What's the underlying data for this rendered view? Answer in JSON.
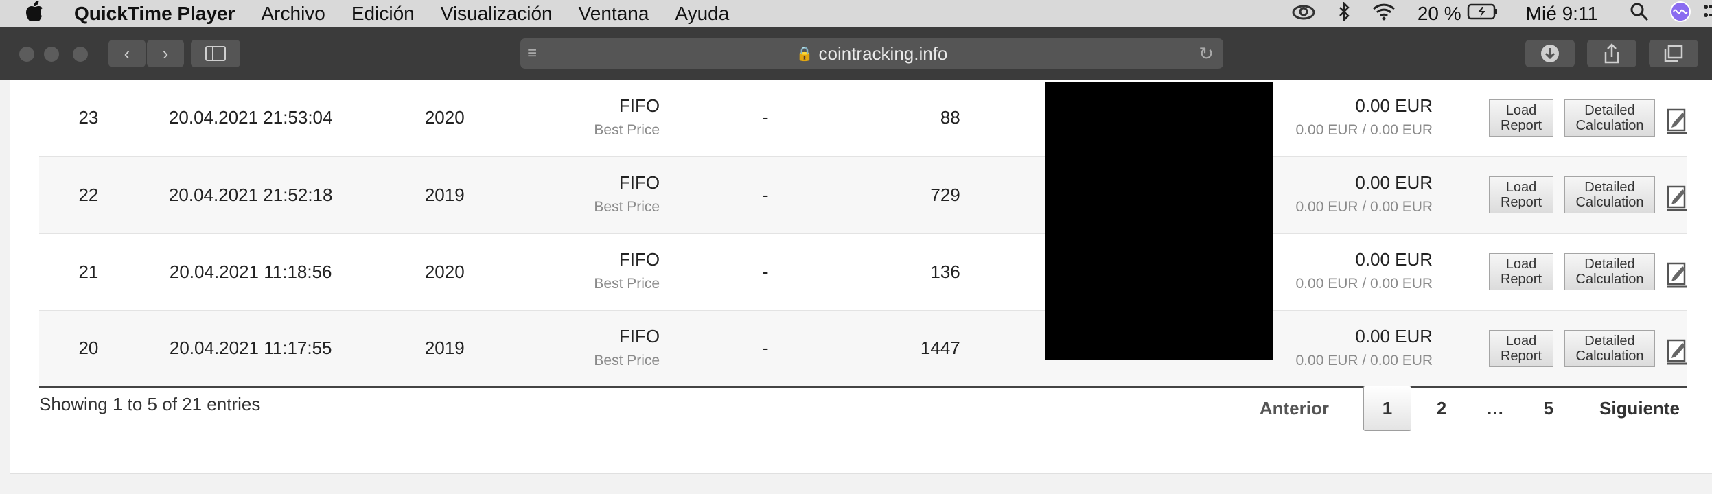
{
  "menubar": {
    "app_name": "QuickTime Player",
    "menus": [
      "Archivo",
      "Edición",
      "Visualización",
      "Ventana",
      "Ayuda"
    ],
    "battery": "20 %",
    "clock": "Mié 9:11"
  },
  "browser": {
    "url": "cointracking.info"
  },
  "table": {
    "rows": [
      {
        "num": "23",
        "date": "20.04.2021 21:53:04",
        "year": "2020",
        "method": "FIFO",
        "method_sub": "Best Price",
        "dash": "-",
        "count": "88",
        "amount": "0.00 EUR",
        "amount_sub": "0.00 EUR / 0.00 EUR",
        "load": "Load Report",
        "detail": "Detailed Calculation"
      },
      {
        "num": "22",
        "date": "20.04.2021 21:52:18",
        "year": "2019",
        "method": "FIFO",
        "method_sub": "Best Price",
        "dash": "-",
        "count": "729",
        "amount": "0.00 EUR",
        "amount_sub": "0.00 EUR / 0.00 EUR",
        "load": "Load Report",
        "detail": "Detailed Calculation"
      },
      {
        "num": "21",
        "date": "20.04.2021 11:18:56",
        "year": "2020",
        "method": "FIFO",
        "method_sub": "Best Price",
        "dash": "-",
        "count": "136",
        "amount": "0.00 EUR",
        "amount_sub": "0.00 EUR / 0.00 EUR",
        "load": "Load Report",
        "detail": "Detailed Calculation"
      },
      {
        "num": "20",
        "date": "20.04.2021 11:17:55",
        "year": "2019",
        "method": "FIFO",
        "method_sub": "Best Price",
        "dash": "-",
        "count": "1447",
        "amount": "0.00 EUR",
        "amount_sub": "0.00 EUR / 0.00 EUR",
        "load": "Load Report",
        "detail": "Detailed Calculation"
      }
    ]
  },
  "footer": {
    "info": "Showing 1 to 5 of 21 entries",
    "prev": "Anterior",
    "pages": [
      "1",
      "2",
      "…",
      "5"
    ],
    "next": "Siguiente"
  }
}
